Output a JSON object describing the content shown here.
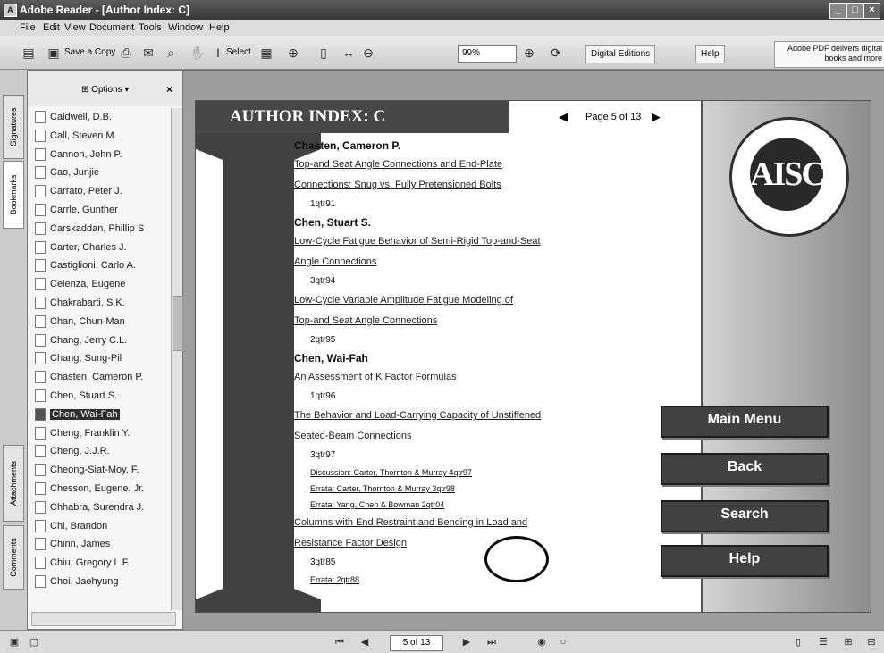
{
  "window": {
    "title": "Adobe Reader - [Author Index: C]",
    "controls": [
      "_",
      "□",
      "×"
    ]
  },
  "menu": [
    "File",
    "Edit",
    "View",
    "Document",
    "Tools",
    "Window",
    "Help"
  ],
  "toolbar": {
    "save_copy": "Save a Copy",
    "select": "Select",
    "zoom": "99%",
    "digital_editions": "Digital Editions",
    "help": "Help",
    "promo": "Adobe PDF delivers digital books and more"
  },
  "left_tabs": [
    "Signatures",
    "Bookmarks",
    "Attachments",
    "Comments"
  ],
  "bookmarks_panel": {
    "options": "Options",
    "items": [
      "Caldwell, D.B.",
      "Call, Steven M.",
      "Cannon, John P.",
      "Cao, Junjie",
      "Carrato, Peter J.",
      "Carrle, Gunther",
      "Carskaddan, Phillip S",
      "Carter, Charles J.",
      "Castiglioni, Carlo A.",
      "Celenza, Eugene",
      "Chakrabarti, S.K.",
      "Chan, Chun-Man",
      "Chang, Jerry C.L.",
      "Chang, Sung-Pil",
      "Chasten, Cameron P.",
      "Chen, Stuart S.",
      "Chen, Wai-Fah",
      "Cheng, Franklin Y.",
      "Cheng, J.J.R.",
      "Cheong-Siat-Moy, F.",
      "Chesson, Eugene, Jr.",
      "Chhabra, Surendra J.",
      "Chi, Brandon",
      "Chinn, James",
      "Chiu, Gregory L.F.",
      "Choi, Jaehyung"
    ],
    "selected_index": 16
  },
  "document": {
    "header": "AUTHOR INDEX: C",
    "page_indicator": "Page 5 of 13",
    "seal_text": "AISC",
    "nav_buttons": [
      "Main Menu",
      "Back",
      "Search",
      "Help"
    ],
    "entries": [
      {
        "type": "author",
        "text": "Chasten, Cameron P."
      },
      {
        "type": "title",
        "text": "Top-and Seat Angle Connections and End-Plate"
      },
      {
        "type": "title",
        "text": "Connections: Snug vs. Fully Pretensioned Bolts"
      },
      {
        "type": "issue",
        "text": "1qtr91"
      },
      {
        "type": "author",
        "text": "Chen, Stuart S."
      },
      {
        "type": "title",
        "text": "Low-Cycle Fatigue Behavior of Semi-Rigid Top-and-Seat"
      },
      {
        "type": "title",
        "text": "Angle Connections"
      },
      {
        "type": "issue",
        "text": "3qtr94"
      },
      {
        "type": "title",
        "text": "Low-Cycle Variable Amplitude Fatigue Modeling of"
      },
      {
        "type": "title",
        "text": "Top-and Seat Angle Connections"
      },
      {
        "type": "issue",
        "text": "2qtr95"
      },
      {
        "type": "author",
        "text": "Chen, Wai-Fah"
      },
      {
        "type": "title",
        "text": "An Assessment of K Factor Formulas"
      },
      {
        "type": "issue",
        "text": "1qtr96"
      },
      {
        "type": "title",
        "text": "The Behavior and Load-Carrying Capacity of Unstiffened"
      },
      {
        "type": "title",
        "text": "Seated-Beam Connections"
      },
      {
        "type": "issue",
        "text": "3qtr97"
      },
      {
        "type": "sub",
        "text": "Discussion: Carter, Thornton & Murray 4qtr97"
      },
      {
        "type": "sub",
        "text": "Errata: Carter, Thornton & Murray 3qtr98"
      },
      {
        "type": "sub",
        "text": "Errata: Yang, Chen & Bowman 2qtr04"
      },
      {
        "type": "title",
        "text": "Columns with End Restraint and Bending in Load and"
      },
      {
        "type": "title",
        "text": "Resistance Factor Design"
      },
      {
        "type": "issue",
        "text": "3qtr85"
      },
      {
        "type": "sub",
        "text": "Errata: 2qtr88"
      }
    ]
  },
  "statusbar": {
    "page": "5 of 13"
  }
}
